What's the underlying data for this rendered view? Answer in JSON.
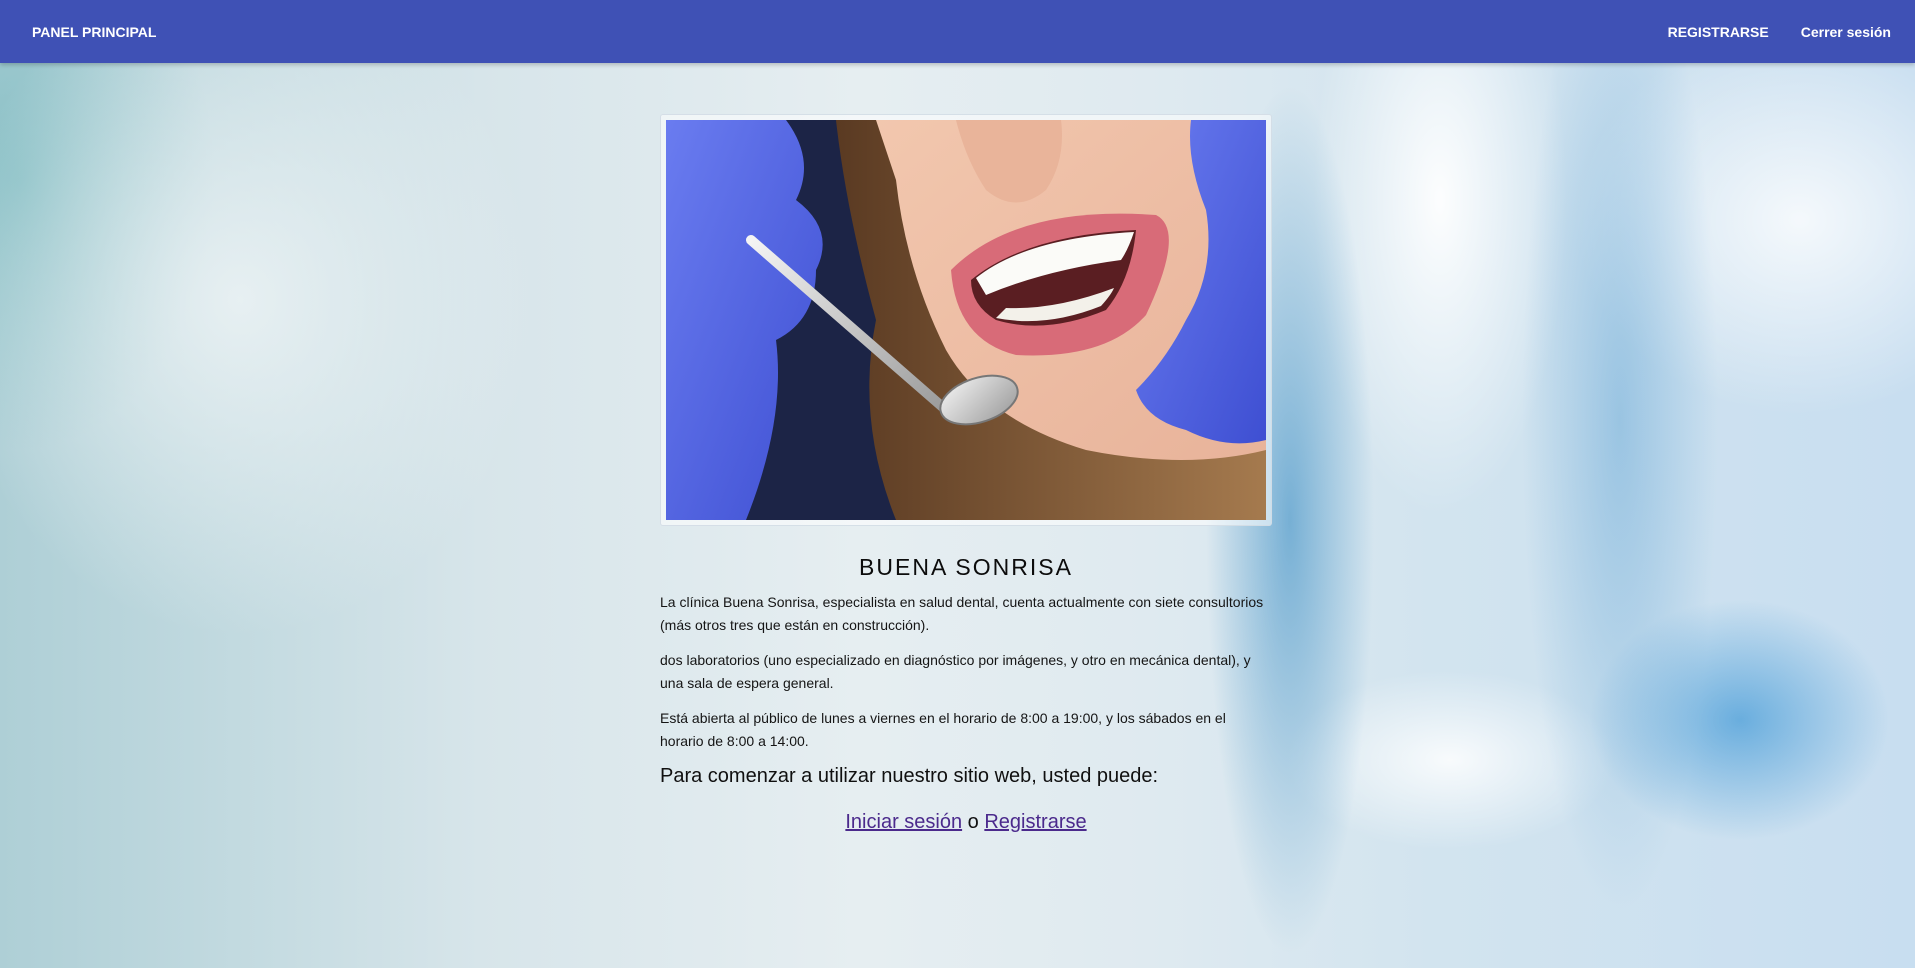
{
  "navbar": {
    "brand": "PANEL PRINCIPAL",
    "links": [
      {
        "label": "REGISTRARSE"
      },
      {
        "label": "Cerrer sesión"
      }
    ],
    "color": "#3f51b5"
  },
  "hero_image": {
    "alt": "dental-smile-photo"
  },
  "main": {
    "title": "BUENA SONRISA",
    "paragraphs": [
      "La clínica Buena Sonrisa, especialista en salud dental, cuenta actualmente con siete consultorios (más otros tres que están en construcción).",
      "dos laboratorios (uno especializado en diagnóstico por imágenes, y otro en mecánica dental), y una sala de espera general.",
      "Está abierta al público de lunes a viernes en el horario de 8:00 a 19:00, y los sábados en el horario de 8:00 a 14:00."
    ],
    "lead": "Para comenzar a utilizar nuestro sitio web, usted puede:",
    "actions": {
      "login": "Iniciar sesión",
      "separator": "o",
      "register": "Registrarse"
    },
    "link_color": "#4b2a8c"
  }
}
